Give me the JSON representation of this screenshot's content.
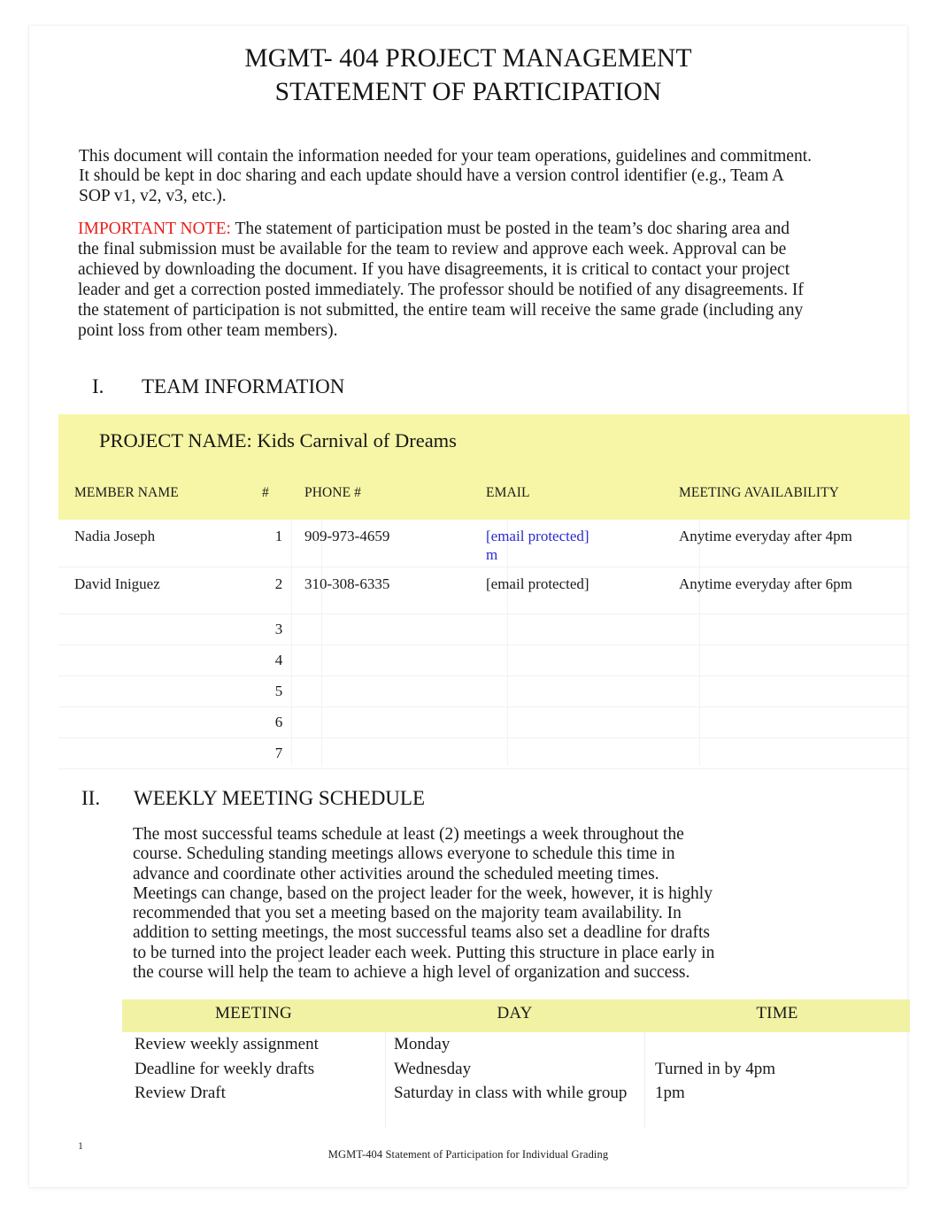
{
  "document": {
    "title_line1": "MGMT- 404 PROJECT MANAGEMENT",
    "title_line2": "STATEMENT OF PARTICIPATION",
    "intro_paragraph": "This document will contain the information needed for your team operations, guidelines and commitment. It should be kept in doc sharing and each update should have a version control identifier (e.g., Team A SOP v1, v2, v3, etc.).",
    "note_label": "IMPORTANT NOTE:",
    "note_body": "The statement of participation must be posted in the team’s doc sharing area and the final submission must be available for the team to review and approve each week. Approval can be achieved by downloading the document. If you have disagreements, it is critical to contact your project leader and get a correction posted immediately. The professor should be notified of any disagreements. If the statement of participation is not submitted, the entire team will receive the same grade (including any point loss from other team members).",
    "highlight_color": "#f6f6a6",
    "note_color": "#e8211c",
    "link_color": "#2a2ad0"
  },
  "section_one": {
    "number": "I.",
    "heading": "TEAM INFORMATION",
    "project_name_label": "PROJECT NAME: Kids Carnival of Dreams",
    "table": {
      "headers": [
        "MEMBER NAME",
        "#",
        "PHONE #",
        "EMAIL",
        "MEETING AVAILABILITY"
      ],
      "rows": [
        {
          "name": "Nadia Joseph",
          "num": "1",
          "phone": "909-973-4659",
          "email": "[email protected]",
          "email_overflow": "m",
          "email_is_link": true,
          "availability": "Anytime everyday after 4pm"
        },
        {
          "name": "David Iniguez",
          "num": "2",
          "phone": "310-308-6335",
          "email": "[email protected]",
          "email_overflow": "",
          "email_is_link": false,
          "availability": "Anytime everyday after 6pm"
        },
        {
          "name": "",
          "num": "3",
          "phone": "",
          "email": "",
          "email_overflow": "",
          "email_is_link": false,
          "availability": ""
        },
        {
          "name": "",
          "num": "4",
          "phone": "",
          "email": "",
          "email_overflow": "",
          "email_is_link": false,
          "availability": ""
        },
        {
          "name": "",
          "num": "5",
          "phone": "",
          "email": "",
          "email_overflow": "",
          "email_is_link": false,
          "availability": ""
        },
        {
          "name": "",
          "num": "6",
          "phone": "",
          "email": "",
          "email_overflow": "",
          "email_is_link": false,
          "availability": ""
        },
        {
          "name": "",
          "num": "7",
          "phone": "",
          "email": "",
          "email_overflow": "",
          "email_is_link": false,
          "availability": ""
        }
      ]
    }
  },
  "section_two": {
    "number": "II.",
    "heading": "WEEKLY MEETING SCHEDULE",
    "paragraph": "The most successful teams schedule at least (2) meetings a week throughout the course. Scheduling standing meetings allows everyone to schedule this time in advance and coordinate other activities around the scheduled meeting times. Meetings can change, based on the project leader for the week, however, it is highly recommended that you set a meeting based on the majority team availability. In addition to setting meetings, the most successful teams also set a deadline for drafts to be turned into the project leader each week. Putting this structure in place early in the course will help the team to achieve a high level of organization and success.",
    "table": {
      "headers": [
        "MEETING",
        "DAY",
        "TIME"
      ],
      "rows": [
        {
          "meeting": "Review weekly assignment",
          "day": "Monday",
          "time": ""
        },
        {
          "meeting": "Deadline for weekly drafts",
          "day": "Wednesday",
          "time": "Turned in by 4pm"
        },
        {
          "meeting": "Review Draft",
          "day": "Saturday in class with while group",
          "time": "1pm"
        }
      ]
    }
  },
  "footer": {
    "page_number": "1",
    "text": "MGMT-404 Statement of Participation for Individual Grading"
  }
}
